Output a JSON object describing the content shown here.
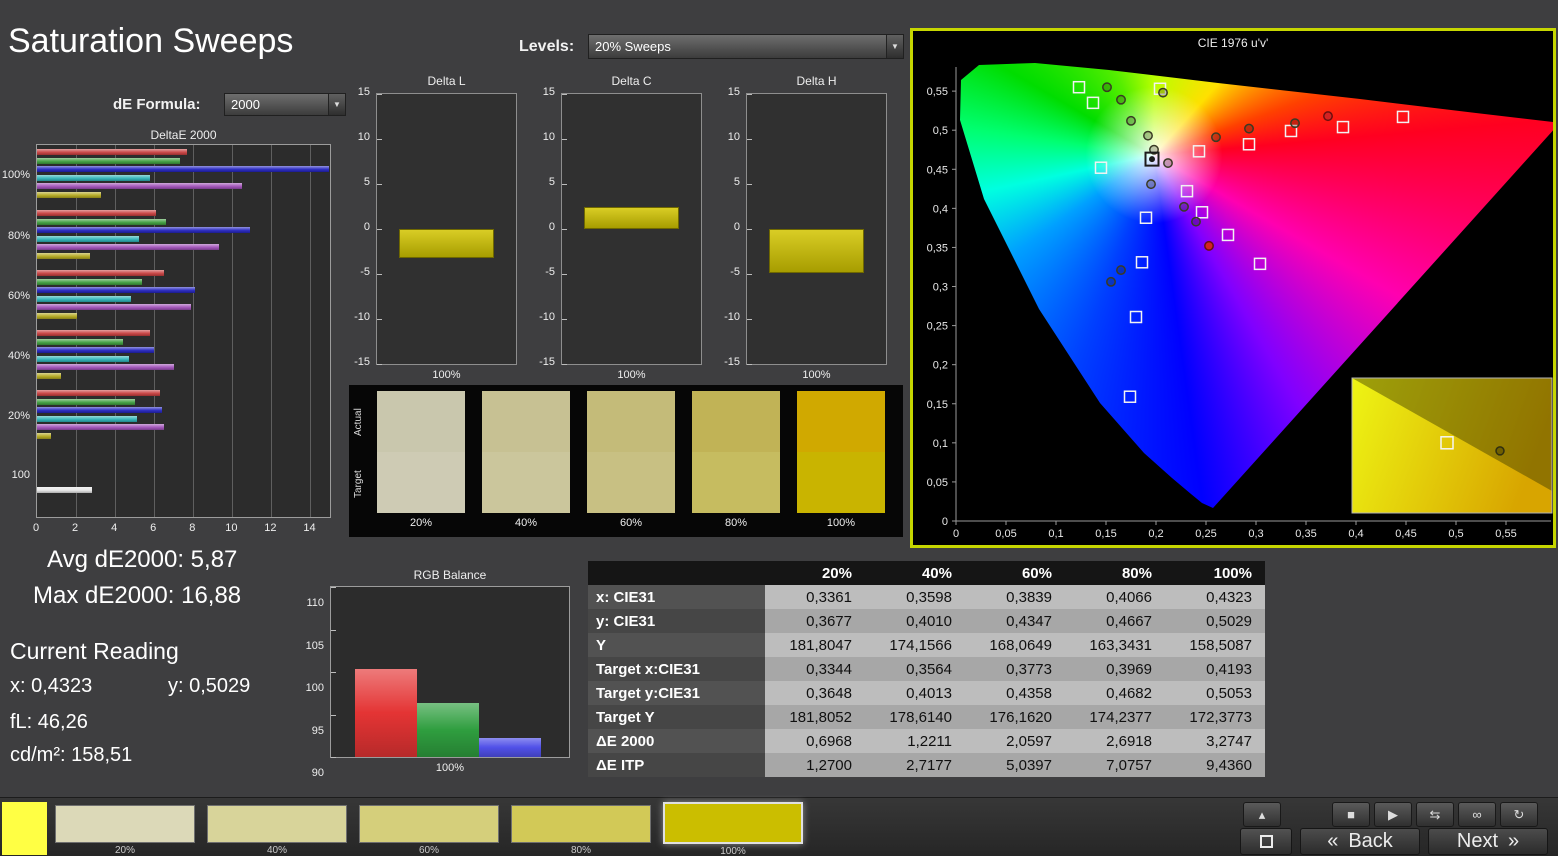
{
  "title": "Saturation Sweeps",
  "de_formula": {
    "label": "dE Formula:",
    "value": "2000"
  },
  "levels": {
    "label": "Levels:",
    "value": "20% Sweeps"
  },
  "icons": {
    "chevron_down": "▼"
  },
  "stats": {
    "avg": "Avg dE2000: 5,87",
    "max": "Max dE2000: 16,88",
    "current_reading": "Current Reading",
    "x": "x: 0,4323",
    "y": "y: 0,5029",
    "fl": "fL: 46,26",
    "cdm2": "cd/m²: 158,51"
  },
  "chart_data": [
    {
      "id": "deltae2000",
      "type": "bar",
      "orientation": "horizontal",
      "title": "DeltaE 2000",
      "xlim": [
        0,
        15
      ],
      "xticks": [
        "0",
        "2",
        "4",
        "6",
        "8",
        "10",
        "12",
        "14"
      ],
      "series_colors": {
        "red": "#c84040",
        "green": "#3f9e3f",
        "blue": "#2525c0",
        "cyan": "#2fb3b8",
        "magenta": "#a050b8",
        "yellow": "#b3a81e",
        "white": "#e6e6e6"
      },
      "groups": [
        {
          "label": "100%",
          "bars": [
            [
              "red",
              7.7
            ],
            [
              "green",
              7.3
            ],
            [
              "blue",
              16.88
            ],
            [
              "cyan",
              5.8
            ],
            [
              "magenta",
              10.5
            ],
            [
              "yellow",
              3.27
            ]
          ]
        },
        {
          "label": "80%",
          "bars": [
            [
              "red",
              6.1
            ],
            [
              "green",
              6.6
            ],
            [
              "blue",
              10.9
            ],
            [
              "cyan",
              5.2
            ],
            [
              "magenta",
              9.3
            ],
            [
              "yellow",
              2.69
            ]
          ]
        },
        {
          "label": "60%",
          "bars": [
            [
              "red",
              6.5
            ],
            [
              "green",
              5.4
            ],
            [
              "blue",
              8.1
            ],
            [
              "cyan",
              4.8
            ],
            [
              "magenta",
              7.9
            ],
            [
              "yellow",
              2.06
            ]
          ]
        },
        {
          "label": "40%",
          "bars": [
            [
              "red",
              5.8
            ],
            [
              "green",
              4.4
            ],
            [
              "blue",
              6.0
            ],
            [
              "cyan",
              4.7
            ],
            [
              "magenta",
              7.0
            ],
            [
              "yellow",
              1.22
            ]
          ]
        },
        {
          "label": "20%",
          "bars": [
            [
              "red",
              6.3
            ],
            [
              "green",
              5.0
            ],
            [
              "blue",
              6.4
            ],
            [
              "cyan",
              5.1
            ],
            [
              "magenta",
              6.5
            ],
            [
              "yellow",
              0.7
            ]
          ]
        },
        {
          "label": "100",
          "bars": [
            [
              "white",
              2.8
            ]
          ]
        }
      ]
    },
    {
      "id": "delta_l",
      "type": "bar",
      "title": "Delta L",
      "xlabel": "100%",
      "ylim": [
        -15,
        15
      ],
      "yticks": [
        "15",
        "10",
        "5",
        "0",
        "-5",
        "-10",
        "-15"
      ],
      "value": -3.2,
      "color": "#b8ad00"
    },
    {
      "id": "delta_c",
      "type": "bar",
      "title": "Delta C",
      "xlabel": "100%",
      "ylim": [
        -15,
        15
      ],
      "yticks": [
        "15",
        "10",
        "5",
        "0",
        "-5",
        "-10",
        "-15"
      ],
      "value": 2.4,
      "color": "#b8ad00"
    },
    {
      "id": "delta_h",
      "type": "bar",
      "title": "Delta H",
      "xlabel": "100%",
      "ylim": [
        -15,
        15
      ],
      "yticks": [
        "15",
        "10",
        "5",
        "0",
        "-5",
        "-10",
        "-15"
      ],
      "value": -4.9,
      "color": "#b8ad00"
    },
    {
      "id": "rgb_balance",
      "type": "bar",
      "title": "RGB Balance",
      "xlabel": "100%",
      "ylim": [
        90,
        110
      ],
      "yticks": [
        "110",
        "105",
        "100",
        "95",
        "90"
      ],
      "series": [
        {
          "name": "Red",
          "value": 100.3,
          "color": "#e43434"
        },
        {
          "name": "Green",
          "value": 96.4,
          "color": "#2f9e3f"
        },
        {
          "name": "Blue",
          "value": 92.2,
          "color": "#5050e8"
        }
      ]
    },
    {
      "id": "cie_1976",
      "type": "scatter",
      "title": "CIE 1976 u'v'",
      "xlim": [
        0,
        0.6
      ],
      "ylim": [
        0,
        0.59
      ],
      "xticks": [
        "0",
        "0,05",
        "0,1",
        "0,15",
        "0,2",
        "0,25",
        "0,3",
        "0,35",
        "0,4",
        "0,45",
        "0,5",
        "0,55"
      ],
      "yticks": [
        "0",
        "0,05",
        "0,1",
        "0,15",
        "0,2",
        "0,25",
        "0,3",
        "0,35",
        "0,4",
        "0,45",
        "0,5",
        "0,55"
      ],
      "white_point": {
        "u": 0.196,
        "v": 0.463
      },
      "targets": [
        [
          0.123,
          0.555
        ],
        [
          0.137,
          0.535
        ],
        [
          0.204,
          0.553
        ],
        [
          0.145,
          0.452
        ],
        [
          0.243,
          0.473
        ],
        [
          0.293,
          0.482
        ],
        [
          0.335,
          0.499
        ],
        [
          0.387,
          0.504
        ],
        [
          0.447,
          0.517
        ],
        [
          0.231,
          0.422
        ],
        [
          0.19,
          0.388
        ],
        [
          0.246,
          0.395
        ],
        [
          0.272,
          0.366
        ],
        [
          0.304,
          0.329
        ],
        [
          0.186,
          0.331
        ],
        [
          0.18,
          0.261
        ],
        [
          0.174,
          0.159
        ]
      ],
      "measurements": [
        [
          0.151,
          0.555,
          ""
        ],
        [
          0.165,
          0.539,
          ""
        ],
        [
          0.207,
          0.548,
          ""
        ],
        [
          0.175,
          0.512,
          ""
        ],
        [
          0.192,
          0.493,
          ""
        ],
        [
          0.26,
          0.491,
          ""
        ],
        [
          0.293,
          0.502,
          ""
        ],
        [
          0.339,
          0.509,
          ""
        ],
        [
          0.372,
          0.518,
          "red"
        ],
        [
          0.198,
          0.475,
          ""
        ],
        [
          0.212,
          0.458,
          ""
        ],
        [
          0.195,
          0.431,
          ""
        ],
        [
          0.228,
          0.402,
          ""
        ],
        [
          0.24,
          0.383,
          ""
        ],
        [
          0.253,
          0.352,
          "red"
        ],
        [
          0.165,
          0.321,
          ""
        ],
        [
          0.155,
          0.306,
          ""
        ]
      ],
      "inset": {
        "target": {
          "x": 0.475,
          "y": 0.48
        },
        "measurement": {
          "x": 0.74,
          "y": 0.54
        }
      }
    }
  ],
  "swatch_strip": {
    "row_labels": [
      "Actual",
      "Target"
    ],
    "columns": [
      {
        "label": "20%",
        "actual": "#c9c7ad",
        "target": "#cecbb4"
      },
      {
        "label": "40%",
        "actual": "#c7c193",
        "target": "#cbc69c"
      },
      {
        "label": "60%",
        "actual": "#c4bb79",
        "target": "#c8c083"
      },
      {
        "label": "80%",
        "actual": "#c1b356",
        "target": "#c6bc60"
      },
      {
        "label": "100%",
        "actual": "#d0a900",
        "target": "#c9b400"
      }
    ]
  },
  "table": {
    "columns": [
      "20%",
      "40%",
      "60%",
      "80%",
      "100%"
    ],
    "rows": [
      {
        "label": "x: CIE31",
        "values": [
          "0,3361",
          "0,3598",
          "0,3839",
          "0,4066",
          "0,4323"
        ]
      },
      {
        "label": "y: CIE31",
        "values": [
          "0,3677",
          "0,4010",
          "0,4347",
          "0,4667",
          "0,5029"
        ]
      },
      {
        "label": "Y",
        "values": [
          "181,8047",
          "174,1566",
          "168,0649",
          "163,3431",
          "158,5087"
        ]
      },
      {
        "label": "Target x:CIE31",
        "values": [
          "0,3344",
          "0,3564",
          "0,3773",
          "0,3969",
          "0,4193"
        ]
      },
      {
        "label": "Target y:CIE31",
        "values": [
          "0,3648",
          "0,4013",
          "0,4358",
          "0,4682",
          "0,5053"
        ]
      },
      {
        "label": "Target Y",
        "values": [
          "181,8052",
          "178,6140",
          "176,1620",
          "174,2377",
          "172,3773"
        ]
      },
      {
        "label": "ΔE 2000",
        "values": [
          "0,6968",
          "1,2211",
          "2,0597",
          "2,6918",
          "3,2747"
        ]
      },
      {
        "label": "ΔE ITP",
        "values": [
          "1,2700",
          "2,7177",
          "5,0397",
          "7,0757",
          "9,4360"
        ]
      }
    ]
  },
  "bottom_bar": {
    "corner_color": "#ffff44",
    "patches": [
      {
        "label": "20%",
        "color": "#dcd9b8",
        "selected": false
      },
      {
        "label": "40%",
        "color": "#d8d49a",
        "selected": false
      },
      {
        "label": "60%",
        "color": "#d5cf7b",
        "selected": false
      },
      {
        "label": "80%",
        "color": "#d2c957",
        "selected": false
      },
      {
        "label": "100%",
        "color": "#cbbe00",
        "selected": true
      }
    ]
  },
  "transport": {
    "buttons": [
      {
        "name": "eject",
        "glyph": "▴"
      },
      {
        "name": "stop",
        "glyph": "■"
      },
      {
        "name": "play",
        "glyph": "▶"
      },
      {
        "name": "step",
        "glyph": "⇆"
      },
      {
        "name": "continuous",
        "glyph": "∞"
      },
      {
        "name": "loop",
        "glyph": "↻"
      }
    ],
    "back_chevrons": "«",
    "back_label": "Back",
    "next_label": "Next",
    "next_chevrons": "»"
  }
}
